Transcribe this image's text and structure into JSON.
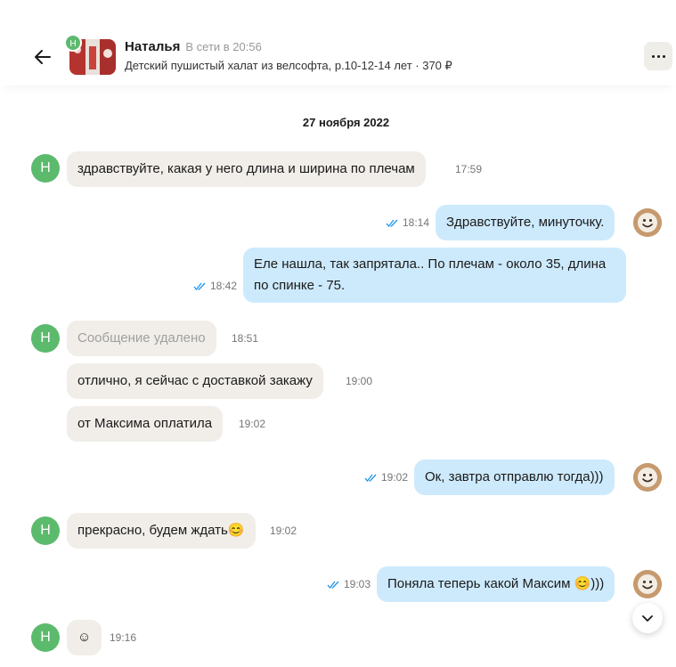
{
  "header": {
    "contact_name": "Наталья",
    "status": "В сети в 20:56",
    "listing": "Детский пушистый халат из велсофта, р.10-12-14 лет · 370 ₽",
    "contact_initial": "Н",
    "back_icon": "arrow-left-icon",
    "more_icon": "more-dots-icon"
  },
  "date_separator": "27 ноября 2022",
  "messages": [
    {
      "dir": "in",
      "text": "здравствуйте, какая у него длина и ширина по плечам",
      "time": "17:59",
      "avatar": "Н"
    },
    {
      "dir": "out",
      "text": "Здравствуйте, минуточку.",
      "time": "18:14"
    },
    {
      "dir": "out",
      "text": "Еле нашла, так запрятала.. По плечам - около 35, длина по спинке - 75.",
      "time": "18:42"
    },
    {
      "dir": "in",
      "text": "Сообщение удалено",
      "time": "18:51",
      "avatar": "Н",
      "deleted": true
    },
    {
      "dir": "in",
      "text": "отлично, я сейчас с доставкой закажу",
      "time": "19:00"
    },
    {
      "dir": "in",
      "text": "от Максима оплатила",
      "time": "19:02"
    },
    {
      "dir": "out",
      "text": "Ок, завтра отправлю тогда)))",
      "time": "19:02"
    },
    {
      "dir": "in",
      "text": "прекрасно, будем ждать😊",
      "time": "19:02",
      "avatar": "Н"
    },
    {
      "dir": "out",
      "text": "Поняла теперь какой Максим 😊)))",
      "time": "19:03"
    },
    {
      "dir": "in",
      "text": "☺",
      "time": "19:16",
      "avatar": "Н"
    }
  ],
  "colors": {
    "incoming_bubble": "#f1eee9",
    "outgoing_bubble": "#cdeafd",
    "avatar_green": "#5cba6c",
    "read_checks": "#1e96e8"
  },
  "scroll_icon": "chevron-down-icon"
}
